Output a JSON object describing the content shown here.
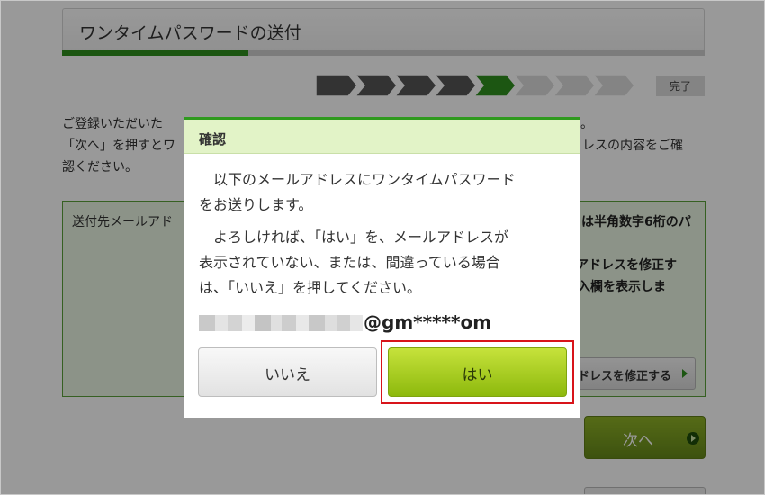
{
  "header": {
    "title": "ワンタイムパスワードの送付",
    "progress_fraction": 0.29
  },
  "steps": {
    "total": 8,
    "current_index": 4,
    "colors": {
      "done": "#555555",
      "current": "#2f8f1f",
      "todo": "#dcdcdc"
    },
    "done_label": "完了"
  },
  "intro": {
    "line1_left": "ご登録いただいた",
    "line1_right": "。",
    "line2_left": "「次へ」を押すとワ",
    "line2_right": "レスの内容をご確",
    "line3": "認ください。"
  },
  "send_box": {
    "label": "送付先メールアド",
    "right_line1": "は半角数字6桁のパ",
    "right_line2": "アドレスを修正す",
    "right_line3": "入欄を表示しま",
    "edit_button": "ドレスを修正する"
  },
  "next_button": {
    "label": "次へ"
  },
  "dialog": {
    "title": "確認",
    "para1_line1": "　以下のメールアドレスにワンタイムパスワード",
    "para1_line2": "をお送りします。",
    "para2_line1": "　よろしければ、「はい」を、メールアドレスが",
    "para2_line2": "表示されていない、または、間違っている場合",
    "para2_line3": "は、「いいえ」を押してください。",
    "email_visible": "@gm*****om",
    "no_button": "いいえ",
    "yes_button": "はい",
    "highlight_color": "#d8141a"
  }
}
